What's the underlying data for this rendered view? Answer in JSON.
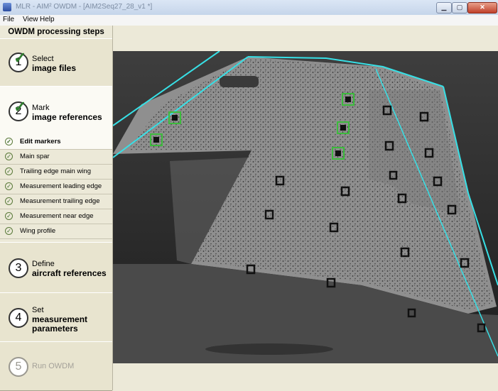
{
  "window": {
    "title": "MLR - AIM² OWDM - [AIM2Seq27_28_v1 *]"
  },
  "menubar": {
    "items": [
      "File",
      "View",
      "Help"
    ]
  },
  "sidebar": {
    "header": "OWDM processing steps",
    "steps": [
      {
        "number": "1",
        "line1": "Select",
        "line2": "image files",
        "state": "done"
      },
      {
        "number": "2",
        "line1": "Mark",
        "line2": "image references",
        "state": "active"
      },
      {
        "number": "3",
        "line1": "Define",
        "line2": "aircraft references",
        "state": "pending"
      },
      {
        "number": "4",
        "line1": "Set",
        "line2": "measurement parameters",
        "state": "pending"
      },
      {
        "number": "5",
        "line1": "Run OWDM",
        "line2": "",
        "state": "disabled"
      }
    ],
    "substeps": [
      "Edit markers",
      "Main spar",
      "Trailing edge main wing",
      "Measurement leading edge",
      "Measurement trailing edge",
      "Measurement near edge",
      "Wing profile"
    ],
    "selected_substep": "Edit markers"
  },
  "colors": {
    "guide_lines": "#37e0e6",
    "selected_marker": "#3dbb3d",
    "marker": "#111111"
  }
}
